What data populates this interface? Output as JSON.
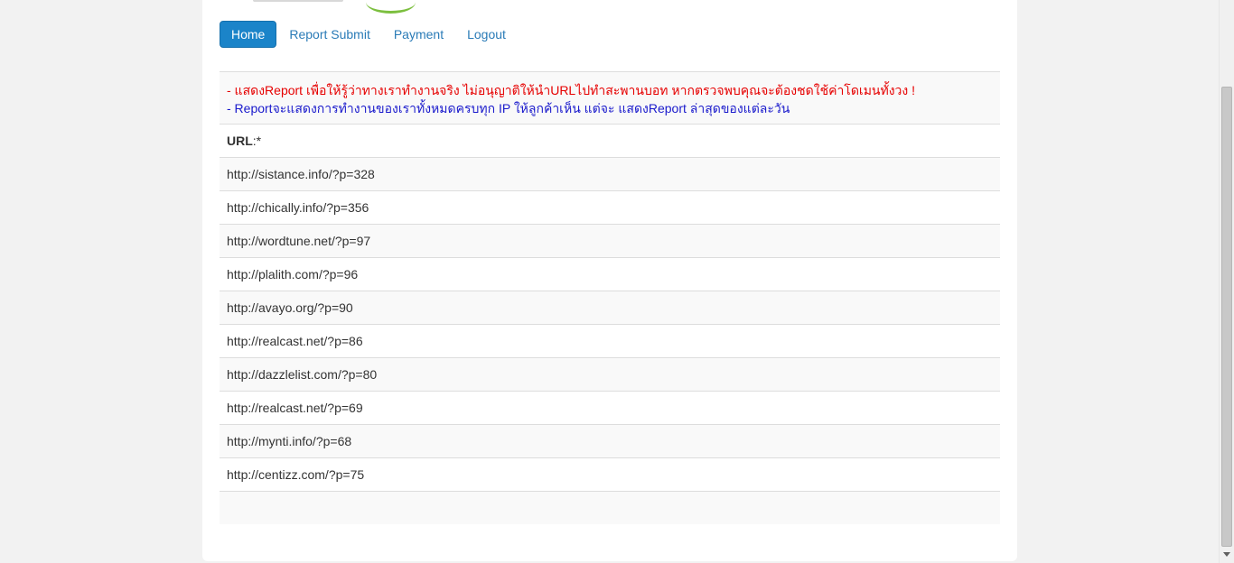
{
  "nav": {
    "items": [
      {
        "label": "Home",
        "active": true
      },
      {
        "label": "Report Submit",
        "active": false
      },
      {
        "label": "Payment",
        "active": false
      },
      {
        "label": "Logout",
        "active": false
      }
    ]
  },
  "notice": {
    "line1": "- แสดงReport เพื่อให้รู้ว่าทางเราทำงานจริง ไม่อนุญาติให้นำURLไปทำสะพานบอท หากตรวจพบคุณจะต้องชดใช้ค่าโดเมนทั้งวง !",
    "line2": "- Reportจะแสดงการทำงานของเราทั้งหมดครบทุก IP ให้ลูกค้าเห็น แต่จะ แสดงReport ล่าสุดของแต่ละวัน"
  },
  "table": {
    "header_label": "URL",
    "header_suffix": ":*",
    "rows": [
      "http://sistance.info/?p=328",
      "http://chically.info/?p=356",
      "http://wordtune.net/?p=97",
      "http://plalith.com/?p=96",
      "http://avayo.org/?p=90",
      "http://realcast.net/?p=86",
      "http://dazzlelist.com/?p=80",
      "http://realcast.net/?p=69",
      "http://mynti.info/?p=68",
      "http://centizz.com/?p=75"
    ]
  },
  "colors": {
    "nav_active_bg": "#1b84c9",
    "link": "#2a7bb7",
    "notice_red": "#e60000",
    "notice_blue": "#1a1acc"
  }
}
